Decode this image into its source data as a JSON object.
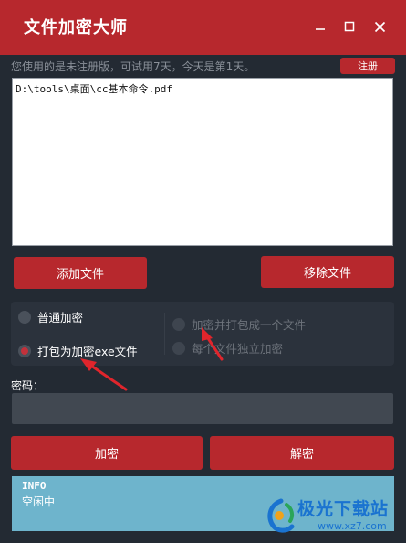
{
  "window": {
    "title": "文件加密大师",
    "minimize_glyph": "—",
    "maximize_glyph": "☐",
    "close_glyph": "✕"
  },
  "notice": {
    "text": "您使用的是未注册版，可试用7天，今天是第1天。",
    "register_label": "注册"
  },
  "file_list": {
    "items": [
      "D:\\tools\\桌面\\cc基本命令.pdf"
    ]
  },
  "buttons": {
    "add_label": "添加文件",
    "remove_label": "移除文件",
    "encrypt_label": "加密",
    "decrypt_label": "解密"
  },
  "options": {
    "normal_label": "普通加密",
    "exe_label": "打包为加密exe文件",
    "pack_label": "加密并打包成一个文件",
    "independent_label": "每个文件独立加密",
    "selected": "exe"
  },
  "password": {
    "label": "密码：",
    "value": ""
  },
  "info": {
    "title": "INFO",
    "status": "空闲中"
  },
  "watermark": {
    "text": "极光下载站",
    "url": "www.xz7.com"
  },
  "colors": {
    "accent": "#b7282d",
    "background": "#232a33",
    "info_panel": "#6eb4cc",
    "annotation_arrow": "#e0252c"
  }
}
